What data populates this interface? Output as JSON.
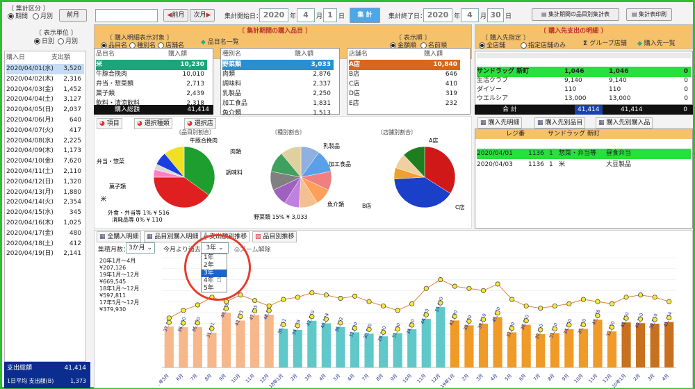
{
  "toolbar": {
    "group_title": "〔 集計区分 〕",
    "radio_a": "期間",
    "radio_b": "月別",
    "month_label": "前月",
    "small_field": "",
    "prev_label": "前月",
    "next_label": "次月",
    "start_label": "集計開始日：",
    "start_year": "2020",
    "start_month": "4",
    "start_day": "1",
    "year_unit": "年",
    "month_unit": "月",
    "day_unit": "日",
    "calc_button": "集 計",
    "end_label": "集計終了日：",
    "end_year": "2020",
    "end_month": "4",
    "end_day": "30",
    "report_button": "集計期間の品目別集計表",
    "export_button": "集計表印刷"
  },
  "left": {
    "group_title": "〔 表示単位 〕",
    "radio_a": "日別",
    "radio_b": "月別",
    "col_date": "購入日",
    "col_amount": "支出額",
    "rows": [
      {
        "date": "2020/04/01(水)",
        "amount": "3,520"
      },
      {
        "date": "2020/04/02(木)",
        "amount": "2,316"
      },
      {
        "date": "2020/04/03(金)",
        "amount": "1,452"
      },
      {
        "date": "2020/04/04(土)",
        "amount": "3,127"
      },
      {
        "date": "2020/04/05(日)",
        "amount": "2,037"
      },
      {
        "date": "2020/04/06(月)",
        "amount": "640"
      },
      {
        "date": "2020/04/07(火)",
        "amount": "417"
      },
      {
        "date": "2020/04/08(水)",
        "amount": "2,225"
      },
      {
        "date": "2020/04/09(木)",
        "amount": "1,173"
      },
      {
        "date": "2020/04/10(金)",
        "amount": "7,620"
      },
      {
        "date": "2020/04/11(土)",
        "amount": "2,110"
      },
      {
        "date": "2020/04/12(日)",
        "amount": "1,320"
      },
      {
        "date": "2020/04/13(月)",
        "amount": "1,880"
      },
      {
        "date": "2020/04/14(火)",
        "amount": "2,354"
      },
      {
        "date": "2020/04/15(水)",
        "amount": "345"
      },
      {
        "date": "2020/04/16(木)",
        "amount": "1,025"
      },
      {
        "date": "2020/04/17(金)",
        "amount": "480"
      },
      {
        "date": "2020/04/18(土)",
        "amount": "412"
      },
      {
        "date": "2020/04/19(日)",
        "amount": "2,141"
      }
    ],
    "total_label": "支出総額",
    "total_value": "41,414",
    "avg_label": "1日平均\n支出額(B)",
    "avg_value": "1,373"
  },
  "center": {
    "title": "〔 集計期間の購入品目 〕",
    "filter_title": "〔 購入明細表示対象 〕",
    "filter_a": "品目名",
    "filter_b": "種別名",
    "filter_c": "店舗名",
    "list_button": "品目名一覧",
    "order_title": "〔 表示順 〕",
    "order_a": "金額順",
    "order_b": "名前順",
    "col1_header": "品目名",
    "col2_header": "購入額",
    "col3_header": "種別名",
    "col4_header": "購入額",
    "col5_header": "店舗名",
    "col6_header": "購入額",
    "items": [
      {
        "name": "米",
        "amount": "10,230"
      },
      {
        "name": "牛豚合挽肉",
        "amount": "10,010"
      },
      {
        "name": "弁当・惣菜類",
        "amount": "2,713"
      },
      {
        "name": "菓子類",
        "amount": "2,439"
      },
      {
        "name": "飲料・清涼飲料",
        "amount": "2,318"
      }
    ],
    "categories": [
      {
        "name": "野菜類",
        "amount": "3,033"
      },
      {
        "name": "肉類",
        "amount": "2,876"
      },
      {
        "name": "調味料",
        "amount": "2,337"
      },
      {
        "name": "乳製品",
        "amount": "2,250"
      },
      {
        "name": "加工食品",
        "amount": "1,831"
      },
      {
        "name": "魚介類",
        "amount": "1,513"
      }
    ],
    "stores": [
      {
        "name": "A店",
        "amount": "10,840"
      },
      {
        "name": "B店",
        "amount": "646"
      },
      {
        "name": "C店",
        "amount": "410"
      },
      {
        "name": "D店",
        "amount": "319"
      },
      {
        "name": "E店",
        "amount": "232"
      }
    ],
    "total_label": "購入総額",
    "total_value": "41,414"
  },
  "pies": {
    "tab_a": "項目",
    "tab_b": "選択種類",
    "tab_c": "選択店",
    "pie1_title": "〔品目別割合〕",
    "pie2_title": "〔種別割合〕",
    "pie3_title": "〔店舗別割合〕",
    "pie1_label_top": "牛豚合挽肉",
    "pie1_label_a": "弁当・惣菜",
    "pie1_label_b": "菓子類",
    "pie1_label_c": "米",
    "pie1_note1": "外食・弁当等 1% ¥ 516",
    "pie1_note2": "消耗品等 0% ¥ 110",
    "pie2_note": "野菜類 15% ¥ 3,033",
    "pie2_label_a": "肉類",
    "pie2_label_b": "調味料",
    "pie2_label_c": "乳製品",
    "pie2_label_d": "加工食品",
    "pie2_label_e": "魚介類",
    "pie3_label_a": "A店",
    "pie3_label_b": "B店",
    "pie3_label_c": "C店"
  },
  "right": {
    "title": "〔 購入先支出の明細 〕",
    "filter_title": "〔 購入先指定 〕",
    "radio_a": "全店舗",
    "radio_b": "指定店舗のみ",
    "group_button": "グループ店舗",
    "add_button": "購入先一覧",
    "rows": [
      {
        "name": "サンドラッグ 新町",
        "a": "1,046",
        "b": "1,046",
        "c": "0"
      },
      {
        "name": "生活クラブ",
        "a": "9,140",
        "b": "9,140",
        "c": "0"
      },
      {
        "name": "ダイソー",
        "a": "110",
        "b": "110",
        "c": "0"
      },
      {
        "name": "ウエルシア",
        "a": "13,000",
        "b": "13,000",
        "c": "0"
      }
    ],
    "total_label": "合 計",
    "total_a": "41,414",
    "total_b": "41,414",
    "total_c": "0",
    "tab_a": "購入先明細",
    "tab_b": "購入先別品目",
    "tab_c": "購入先別購入品",
    "detail_header_a": "レジ番",
    "detail_header_b": "サンドラッグ 新町",
    "detail_rows": [
      {
        "date": "2020/04/01",
        "no": "1136",
        "q": "1",
        "item": "惣菜・弁当等",
        "shop": "昼食弁当"
      },
      {
        "date": "2020/04/03",
        "no": "1136",
        "q": "1",
        "item": "米",
        "shop": "大豆製品"
      }
    ]
  },
  "bottom": {
    "tab_a": "全購入明細",
    "tab_b": "品目別購入明細",
    "tab_c": "支出額別推移",
    "tab_d": "品目別推移",
    "months_label": "集積月数：",
    "months_value": "3か月",
    "compare_label": "今月より過去",
    "years_value": "3年",
    "zoom_label": "ズーム解除",
    "dropdown": [
      "1年",
      "2年",
      "3年",
      "4年",
      "5年"
    ],
    "legend": [
      "20年1月～4月 ¥207,126",
      "19年1月～12月 ¥669,545",
      "18年1月～12月 ¥597,811",
      "17年5月～12月 ¥379,930"
    ]
  },
  "chart_data": {
    "type": "bar",
    "categories": [
      "17年5月",
      "6月",
      "7月",
      "8月",
      "9月",
      "10月",
      "11月",
      "12月",
      "18年1月",
      "2月",
      "3月",
      "4月",
      "5月",
      "6月",
      "7月",
      "8月",
      "9月",
      "10月",
      "11月",
      "12月",
      "19年1月",
      "2月",
      "3月",
      "4月",
      "5月",
      "6月",
      "7月",
      "8月",
      "9月",
      "10月",
      "11月",
      "12月",
      "20年1月",
      "2月",
      "3月",
      "4月"
    ],
    "series": [
      {
        "name": "月別支出額",
        "values": [
          37190,
          36690,
          36820,
          31691,
          49888,
          42723,
          47715,
          48060,
          35251,
          34228,
          42540,
          40224,
          36792,
          32000,
          30840,
          28340,
          31200,
          34820,
          44230,
          55000,
          42800,
          38380,
          39850,
          45870,
          32000,
          38850,
          30450,
          31310,
          34950,
          35120,
          43478,
          32850,
          41050,
          40350,
          39850,
          41414
        ]
      },
      {
        "name": "平均",
        "values": [
          45000,
          52000,
          57000,
          64000,
          60000,
          66000,
          61000,
          56000,
          62000,
          64000,
          68000,
          66000,
          63000,
          65000,
          60000,
          56000,
          52000,
          58000,
          72000,
          80000,
          74000,
          72000,
          70000,
          76000,
          62000,
          56000,
          54000,
          56000,
          58000,
          62000,
          60000,
          58000,
          64000,
          66000,
          64000,
          60000
        ]
      }
    ],
    "ylim": [
      0,
      100000
    ]
  }
}
